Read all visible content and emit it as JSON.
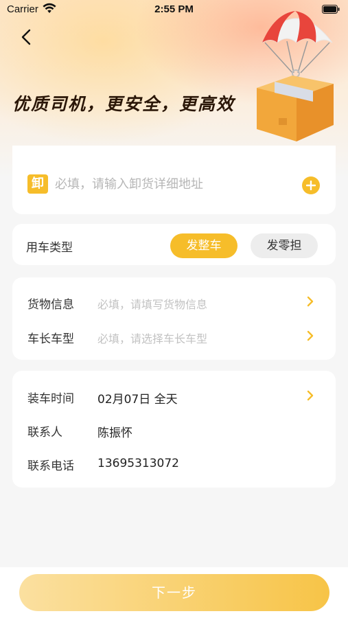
{
  "status_bar": {
    "carrier": "Carrier",
    "time": "2:55 PM",
    "wifi_icon": "wifi-icon",
    "battery_icon": "battery-icon"
  },
  "header": {
    "back_icon": "chevron-left-icon",
    "slogan": "优质司机，更安全，更高效",
    "illustration_icon": "parachute-box-icon"
  },
  "address": {
    "icon_text": "卸",
    "placeholder": "必填，请输入卸货详细地址",
    "add_icon": "plus-circle-icon"
  },
  "vehicle_type": {
    "label": "用车类型",
    "options": [
      {
        "label": "发整车",
        "selected": true
      },
      {
        "label": "发零担",
        "selected": false
      }
    ]
  },
  "cargo": {
    "rows": [
      {
        "label": "货物信息",
        "placeholder": "必填，请填写货物信息"
      },
      {
        "label": "车长车型",
        "placeholder": "必填，请选择车长车型"
      }
    ]
  },
  "loading": {
    "rows": [
      {
        "label": "装车时间",
        "value": "02月07日 全天"
      },
      {
        "label": "联系人",
        "value": "陈振怀"
      },
      {
        "label": "联系电话",
        "value": "13695313072"
      }
    ]
  },
  "footer": {
    "next_label": "下一步"
  },
  "colors": {
    "accent": "#f6bd2a",
    "background": "#f6f6f6",
    "placeholder": "#b6b6b6"
  }
}
